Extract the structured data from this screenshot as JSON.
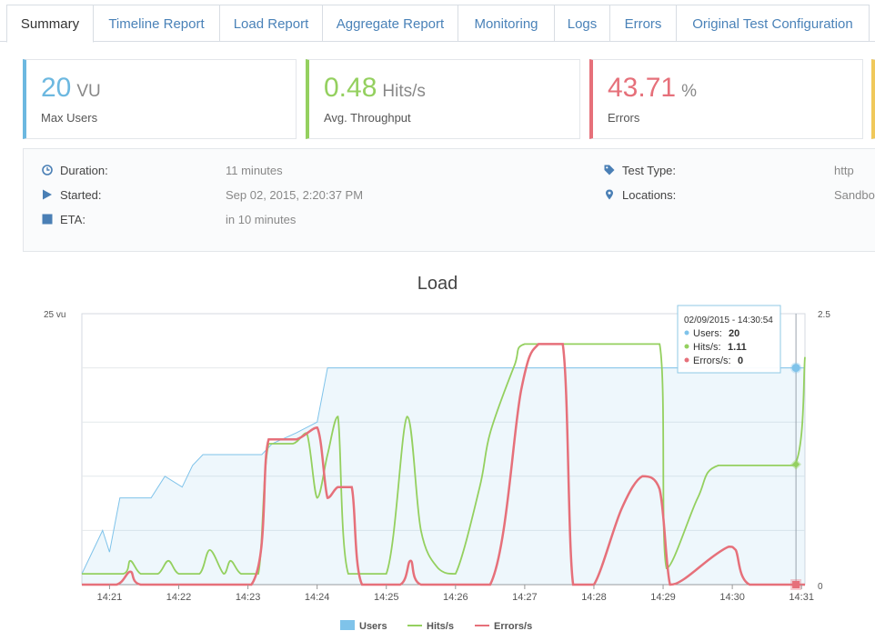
{
  "tabs": [
    {
      "label": "Summary",
      "active": true
    },
    {
      "label": "Timeline Report"
    },
    {
      "label": "Load Report"
    },
    {
      "label": "Aggregate Report"
    },
    {
      "label": "Monitoring"
    },
    {
      "label": "Logs"
    },
    {
      "label": "Errors"
    },
    {
      "label": "Original Test Configuration"
    }
  ],
  "cards": [
    {
      "value": "20",
      "unit": "VU",
      "label": "Max Users",
      "color": "#6cb8e0"
    },
    {
      "value": "0.48",
      "unit": "Hits/s",
      "label": "Avg. Throughput",
      "color": "#94d05f"
    },
    {
      "value": "43.71",
      "unit": "%",
      "label": "Errors",
      "color": "#e6707a"
    }
  ],
  "info": {
    "duration_label": "Duration:",
    "duration": "11 minutes",
    "started_label": "Started:",
    "started": "Sep 02, 2015, 2:20:37 PM",
    "eta_label": "ETA:",
    "eta": "in 10 minutes",
    "test_type_label": "Test Type:",
    "test_type": "http",
    "locations_label": "Locations:",
    "locations": "Sandbo"
  },
  "chart_data": {
    "type": "line",
    "title": "Load",
    "x": [
      "14:21",
      "14:22",
      "14:23",
      "14:24",
      "14:25",
      "14:26",
      "14:27",
      "14:28",
      "14:29",
      "14:30",
      "14:31"
    ],
    "y_left_label": "25 vu",
    "y_left_range": [
      0,
      25
    ],
    "y_right_range": [
      0,
      2.5
    ],
    "y_right_ticks": [
      "2.5",
      "0"
    ],
    "series": [
      {
        "name": "Users",
        "color": "#7fc3ea",
        "kind": "area",
        "points": [
          [
            20.6,
            1
          ],
          [
            20.9,
            5
          ],
          [
            21.0,
            3
          ],
          [
            21.15,
            8
          ],
          [
            21.6,
            8
          ],
          [
            21.8,
            10
          ],
          [
            22.05,
            9
          ],
          [
            22.2,
            11
          ],
          [
            22.35,
            12
          ],
          [
            23.2,
            12
          ],
          [
            23.35,
            13
          ],
          [
            23.7,
            14
          ],
          [
            24.0,
            15
          ],
          [
            24.15,
            20
          ],
          [
            31.0,
            20
          ],
          [
            31.05,
            20
          ]
        ]
      },
      {
        "name": "Hits/s",
        "color": "#94d05f",
        "kind": "line",
        "points": [
          [
            20.6,
            0.1
          ],
          [
            21.2,
            0.1
          ],
          [
            21.3,
            0.22
          ],
          [
            21.45,
            0.1
          ],
          [
            21.7,
            0.1
          ],
          [
            21.85,
            0.22
          ],
          [
            22.0,
            0.1
          ],
          [
            22.3,
            0.1
          ],
          [
            22.45,
            0.32
          ],
          [
            22.65,
            0.1
          ],
          [
            22.75,
            0.22
          ],
          [
            22.9,
            0.1
          ],
          [
            23.15,
            0.1
          ],
          [
            23.3,
            1.3
          ],
          [
            23.65,
            1.3
          ],
          [
            23.85,
            1.4
          ],
          [
            24.0,
            0.8
          ],
          [
            24.15,
            1.2
          ],
          [
            24.3,
            1.55
          ],
          [
            24.45,
            0.1
          ],
          [
            25.0,
            0.1
          ],
          [
            25.3,
            1.55
          ],
          [
            25.5,
            0.5
          ],
          [
            25.75,
            0.15
          ],
          [
            26.0,
            0.1
          ],
          [
            26.35,
            0.9
          ],
          [
            26.5,
            1.4
          ],
          [
            26.85,
            2.02
          ],
          [
            27.0,
            2.22
          ],
          [
            28.0,
            2.22
          ],
          [
            28.95,
            2.22
          ],
          [
            29.05,
            0.15
          ],
          [
            29.5,
            0.8
          ],
          [
            29.8,
            1.1
          ],
          [
            30.9,
            1.1
          ],
          [
            31.05,
            2.1
          ]
        ]
      },
      {
        "name": "Errors/s",
        "color": "#e6707a",
        "kind": "line",
        "points": [
          [
            20.6,
            0
          ],
          [
            21.1,
            0
          ],
          [
            21.3,
            0.12
          ],
          [
            21.45,
            0
          ],
          [
            23.05,
            0
          ],
          [
            23.3,
            1.34
          ],
          [
            23.7,
            1.34
          ],
          [
            24.0,
            1.45
          ],
          [
            24.15,
            0.8
          ],
          [
            24.3,
            0.9
          ],
          [
            24.5,
            0.9
          ],
          [
            24.65,
            0
          ],
          [
            25.2,
            0
          ],
          [
            25.35,
            0.22
          ],
          [
            25.5,
            0
          ],
          [
            26.5,
            0
          ],
          [
            26.95,
            1.8
          ],
          [
            27.2,
            2.22
          ],
          [
            27.55,
            2.22
          ],
          [
            27.7,
            0
          ],
          [
            28.0,
            0
          ],
          [
            28.4,
            0.7
          ],
          [
            28.7,
            1.0
          ],
          [
            28.95,
            0.88
          ],
          [
            29.1,
            0
          ],
          [
            29.3,
            0.05
          ],
          [
            29.7,
            0.25
          ],
          [
            29.95,
            0.35
          ],
          [
            30.05,
            0.32
          ],
          [
            30.25,
            0
          ],
          [
            31.05,
            0
          ]
        ]
      }
    ],
    "tooltip": {
      "title": "02/09/2015 - 14:30:54",
      "rows": [
        {
          "label": "Users:",
          "value": "20",
          "color": "#7fc3ea"
        },
        {
          "label": "Hits/s:",
          "value": "1.11",
          "color": "#94d05f"
        },
        {
          "label": "Errors/s:",
          "value": "0",
          "color": "#e6707a"
        }
      ]
    },
    "cursor_x": 30.92,
    "legend": [
      "Users",
      "Hits/s",
      "Errors/s"
    ],
    "legend_position": "bottom"
  }
}
